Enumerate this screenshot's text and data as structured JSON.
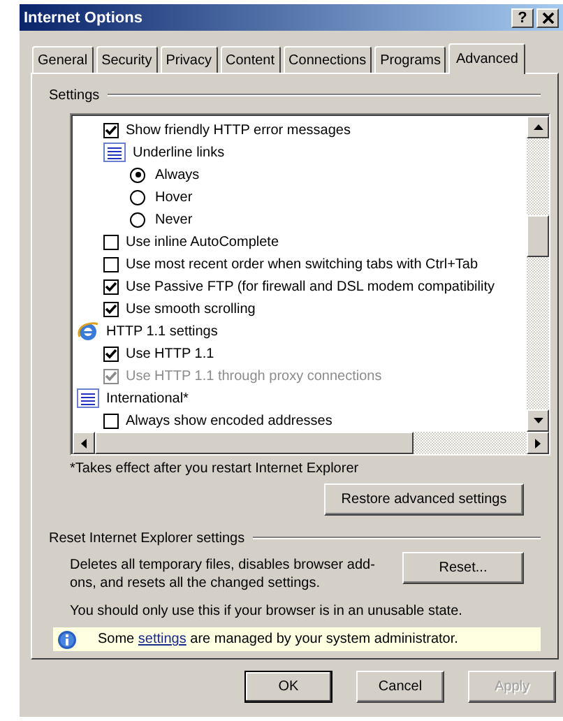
{
  "window": {
    "title": "Internet Options",
    "help_button": "?"
  },
  "tabs": [
    {
      "label": "General",
      "selected": false
    },
    {
      "label": "Security",
      "selected": false
    },
    {
      "label": "Privacy",
      "selected": false
    },
    {
      "label": "Content",
      "selected": false
    },
    {
      "label": "Connections",
      "selected": false
    },
    {
      "label": "Programs",
      "selected": false
    },
    {
      "label": "Advanced",
      "selected": true
    }
  ],
  "settings": {
    "heading": "Settings",
    "continued_items": [
      {
        "kind": "checkbox",
        "label": "Show friendly HTTP error messages",
        "checked": true,
        "disabled": false
      },
      {
        "kind": "list-group",
        "label": "Underline links",
        "children": [
          {
            "kind": "radio",
            "label": "Always",
            "selected": true,
            "disabled": false
          },
          {
            "kind": "radio",
            "label": "Hover",
            "selected": false,
            "disabled": false
          },
          {
            "kind": "radio",
            "label": "Never",
            "selected": false,
            "disabled": false
          }
        ]
      },
      {
        "kind": "checkbox",
        "label": "Use inline AutoComplete",
        "checked": false,
        "disabled": false
      },
      {
        "kind": "checkbox",
        "label": "Use most recent order when switching tabs with Ctrl+Tab",
        "checked": false,
        "disabled": false
      },
      {
        "kind": "checkbox",
        "label": "Use Passive FTP (for firewall and DSL modem compatibility",
        "checked": true,
        "disabled": false
      },
      {
        "kind": "checkbox",
        "label": "Use smooth scrolling",
        "checked": true,
        "disabled": false
      }
    ],
    "groups": [
      {
        "kind": "browser-group",
        "label": "HTTP 1.1 settings",
        "children": [
          {
            "kind": "checkbox",
            "label": "Use HTTP 1.1",
            "checked": true,
            "disabled": false
          },
          {
            "kind": "checkbox",
            "label": "Use HTTP 1.1 through proxy connections",
            "checked": true,
            "disabled": true
          }
        ]
      },
      {
        "kind": "list-group",
        "label": "International*",
        "children": [
          {
            "kind": "checkbox",
            "label": "Always show encoded addresses",
            "checked": false,
            "disabled": false
          }
        ]
      }
    ],
    "note": "*Takes effect after you restart Internet Explorer",
    "restore_button": "Restore advanced settings"
  },
  "reset": {
    "heading": "Reset Internet Explorer settings",
    "description": "Deletes all temporary files, disables browser add-ons, and resets all the changed settings.",
    "button": "Reset...",
    "warning": "You should only use this if your browser is in an unusable state."
  },
  "info_bar": {
    "before": "Some ",
    "link": "settings",
    "after": " are managed by your system administrator."
  },
  "buttons": [
    {
      "label": "OK",
      "disabled": false,
      "default": true
    },
    {
      "label": "Cancel",
      "disabled": false,
      "default": false
    },
    {
      "label": "Apply",
      "disabled": true,
      "default": false
    }
  ]
}
